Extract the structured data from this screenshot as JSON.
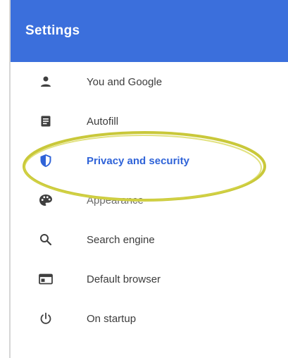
{
  "header": {
    "title": "Settings"
  },
  "colors": {
    "header_bg": "#3b6fdc",
    "active_text": "#2f63d8",
    "icon": "#3f3f3f",
    "highlight_ring": "#c9c83a"
  },
  "nav": {
    "items": [
      {
        "label": "You and Google",
        "icon": "person-icon"
      },
      {
        "label": "Autofill",
        "icon": "clipboard-icon"
      },
      {
        "label": "Privacy and security",
        "icon": "shield-icon",
        "active": true
      },
      {
        "label": "Appearance",
        "icon": "palette-icon"
      },
      {
        "label": "Search engine",
        "icon": "search-icon"
      },
      {
        "label": "Default browser",
        "icon": "browser-window-icon"
      },
      {
        "label": "On startup",
        "icon": "power-icon"
      }
    ]
  }
}
